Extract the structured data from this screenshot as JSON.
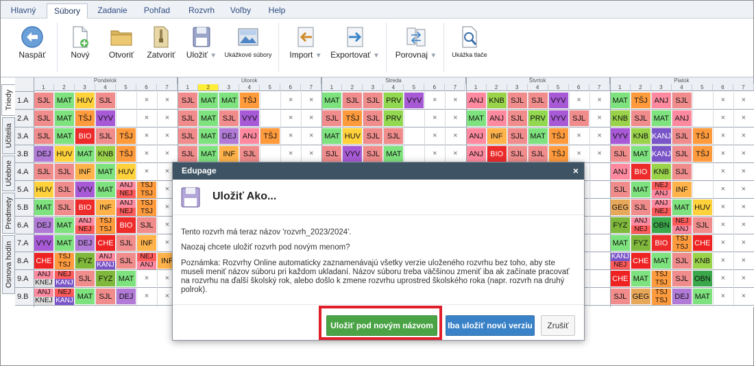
{
  "menu": {
    "tabs": [
      {
        "label": "Hlavný",
        "active": false
      },
      {
        "label": "Súbory",
        "active": true
      },
      {
        "label": "Zadanie",
        "active": false
      },
      {
        "label": "Pohľad",
        "active": false
      },
      {
        "label": "Rozvrh",
        "active": false
      },
      {
        "label": "Voľby",
        "active": false
      },
      {
        "label": "Help",
        "active": false
      }
    ]
  },
  "ribbon": {
    "back": "Naspäť",
    "new": "Nový",
    "open": "Otvoriť",
    "close": "Zatvoriť",
    "save": "Uložiť",
    "samples": "Ukážkové súbory",
    "import": "Import",
    "export": "Exportovať",
    "compare": "Porovnaj",
    "print_preview": "Ukážka tlače"
  },
  "side_tabs": [
    "Triedy",
    "Učitelia",
    "Učebne",
    "Predmety",
    "Osnova hodín"
  ],
  "timetable": {
    "days": [
      "Pondelok",
      "Utorok",
      "Streda",
      "Štvrtok",
      "Piatok"
    ],
    "periods": [
      "1",
      "2",
      "3",
      "4",
      "5",
      "6",
      "7"
    ],
    "highlight_period": {
      "day": 1,
      "period": 1
    },
    "classes": [
      "1.A",
      "2.A",
      "3.A",
      "3.B",
      "4.A",
      "5.A",
      "5.B",
      "6.A",
      "7.A",
      "8.A",
      "9.A",
      "9.B"
    ],
    "empty_mark": "×",
    "subject_colors": {
      "SJL": "#f08c8c",
      "MAT": "#7ee37e",
      "HUV": "#ffd23c",
      "TŠJ": "#ff9b3c",
      "ANJ": "#ff8aa0",
      "VYV": "#a85ad6",
      "BIO": "#ee2b2b",
      "INF": "#ffb34a",
      "DEJ": "#b07ad6",
      "PRV": "#92d850",
      "KNB": "#9ad34a",
      "NEJ": "#ff5a5a",
      "FYZ": "#7fb83a",
      "CHE": "#ee2222",
      "OBN": "#3aa84a",
      "GEG": "#e8a85a",
      "KANJ": "#7a55c8"
    },
    "rows": [
      [
        [
          "SJL",
          "MAT",
          "HUV",
          "SJL",
          "",
          "x",
          "x"
        ],
        [
          "SJL",
          "MAT",
          "MAT",
          "TŠJ",
          "",
          "x",
          "x"
        ],
        [
          "MAT",
          "SJL",
          "SJL",
          "PRV",
          "VYV",
          "x",
          "x"
        ],
        [
          "ANJ",
          "KNB",
          "SJL",
          "SJL",
          "VYV",
          "x",
          "x"
        ],
        [
          "MAT",
          "TŠJ",
          "ANJ",
          "SJL",
          "",
          "x",
          "x"
        ]
      ],
      [
        [
          "SJL",
          "MAT",
          "TŠJ",
          "VYV",
          "",
          "x",
          "x"
        ],
        [
          "SJL",
          "MAT",
          "SJL",
          "VYV",
          "",
          "x",
          "x"
        ],
        [
          "SJL",
          "TŠJ",
          "SJL",
          "PRV",
          "",
          "x",
          "x"
        ],
        [
          "MAT",
          "ANJ",
          "SJL",
          "PRV",
          "VYV",
          "SJL",
          "x"
        ],
        [
          "KNB",
          "SJL",
          "MAT",
          "ANJ",
          "",
          "x",
          "x"
        ]
      ],
      [
        [
          "SJL",
          "MAT",
          "BIO",
          "SJL",
          "TŠJ",
          "x",
          "x"
        ],
        [
          "SJL",
          "MAT",
          "DEJ",
          "ANJ",
          "TŠJ",
          "x",
          "x"
        ],
        [
          "MAT",
          "HUV",
          "SJL",
          "SJL",
          "",
          "x",
          "x"
        ],
        [
          "ANJ",
          "INF",
          "SJL",
          "MAT",
          "TŠJ",
          "x",
          "x"
        ],
        [
          "VYV",
          "KNB",
          "KANJ",
          "SJL",
          "TŠJ",
          "x",
          "x"
        ]
      ],
      [
        [
          "DEJ",
          "HUV",
          "MAT",
          "KNB",
          "TŠJ",
          "x",
          "x"
        ],
        [
          "SJL",
          "MAT",
          "INF",
          "SJL",
          "",
          "x",
          "x"
        ],
        [
          "SJL",
          "VYV",
          "SJL",
          "MAT",
          "",
          "x",
          "x"
        ],
        [
          "ANJ",
          "BIO",
          "SJL",
          "SJL",
          "TŠJ",
          "x",
          "x"
        ],
        [
          "SJL",
          "MAT",
          "KANJ",
          "SJL",
          "TŠJ",
          "x",
          "x"
        ]
      ],
      [
        [
          "SJL",
          "SJL",
          "INF",
          "MAT",
          "HUV",
          "x",
          "x"
        ],
        [],
        [],
        [],
        [
          "ANJ",
          "BIO",
          "KNB",
          "SJL",
          "",
          "x",
          "x"
        ]
      ],
      [
        [
          "HUV",
          "SJL",
          "VYV",
          "MAT",
          "ANJ/NEJ",
          "TŠJ/TŠJ",
          "x"
        ],
        [],
        [],
        [],
        [
          "SJL",
          "MAT",
          "NEJ/ANJ",
          "INF",
          "",
          "x",
          "x"
        ]
      ],
      [
        [
          "MAT",
          "SJL",
          "BIO",
          "INF",
          "ANJ/NEJ",
          "TŠJ/TŠJ",
          "x"
        ],
        [],
        [],
        [],
        [
          "GEG",
          "SJL",
          "ANJ/NEJ",
          "MAT",
          "HUV",
          "x",
          "x"
        ]
      ],
      [
        [
          "DEJ",
          "MAT",
          "ANJ/NEJ",
          "TŠJ/TŠJ",
          "BIO",
          "SJL",
          "x"
        ],
        [],
        [],
        [],
        [
          "FYZ",
          "ANJ/NEJ",
          "OBN",
          "NEJ/ANJ",
          "SJL",
          "x",
          "x"
        ]
      ],
      [
        [
          "VYV",
          "MAT",
          "DEJ",
          "CHE",
          "SJL",
          "INF",
          "x"
        ],
        [],
        [],
        [],
        [
          "MAT",
          "FYZ",
          "BIO",
          "TŠJ/TŠJ",
          "CHE",
          "x",
          "x"
        ]
      ],
      [
        [
          "CHE",
          "TŠJ/TŠJ",
          "FYZ",
          "ANJ/KANJ",
          "SJL",
          "NEJ/ANJ",
          "INF"
        ],
        [],
        [],
        [],
        [
          "KANJ/NEJ",
          "CHE",
          "MAT",
          "SJL",
          "KNB",
          "x",
          "x"
        ]
      ],
      [
        [
          "ANJ/KNEJ",
          "NEJ/KANJ",
          "SJL",
          "FYZ",
          "MAT",
          "x",
          "x"
        ],
        [],
        [],
        [],
        [
          "CHE",
          "MAT",
          "TŠJ/TŠJ",
          "SJL",
          "OBN",
          "x",
          "x"
        ]
      ],
      [
        [
          "ANJ/KNEJ",
          "NEJ/KANJ",
          "MAT",
          "SJL",
          "DEJ",
          "x",
          "x"
        ],
        [],
        [],
        [],
        [
          "SJL",
          "GEG",
          "TŠJ/TŠJ",
          "DEJ",
          "MAT",
          "x",
          "x"
        ]
      ]
    ]
  },
  "dialog": {
    "header": "Edupage",
    "close": "×",
    "title": "Uložiť Ako...",
    "p1": "Tento rozvrh má teraz názov 'rozvrh_2023/2024'.",
    "p2": "Naozaj chcete uložiť rozvrh pod novým menom?",
    "p3": "Poznámka: Rozvrhy Online automaticky zaznamenávajú všetky verzie uloženého rozvrhu bez toho, aby ste museli meniť názov súboru pri každom ukladaní. Názov súboru treba väčšinou zmeniť iba ak začínate pracovať na rozvrhu na ďalší školský rok, alebo došlo k zmene rozvrhu uprostred školského roka (napr. rozvrh na druhý polrok).",
    "btn_save_new": "Uložiť pod novým názvom",
    "btn_save_version": "Iba uložiť novú verziu",
    "btn_cancel": "Zrušiť"
  }
}
